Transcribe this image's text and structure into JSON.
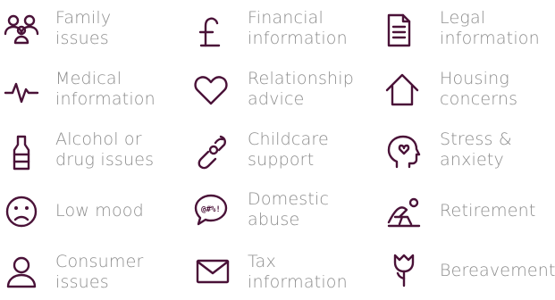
{
  "items": [
    {
      "label": "Family\nissues",
      "icon": "family-icon"
    },
    {
      "label": "Financial\ninformation",
      "icon": "pound-icon"
    },
    {
      "label": "Legal\ninformation",
      "icon": "document-icon"
    },
    {
      "label": "Medical\ninformation",
      "icon": "heartbeat-icon"
    },
    {
      "label": "Relationship\nadvice",
      "icon": "heart-icon"
    },
    {
      "label": "Housing\nconcerns",
      "icon": "house-icon"
    },
    {
      "label": "Alcohol or\ndrug issues",
      "icon": "bottle-icon"
    },
    {
      "label": "Childcare\nsupport",
      "icon": "pacifier-icon"
    },
    {
      "label": "Stress &\nanxiety",
      "icon": "head-icon"
    },
    {
      "label": "Low mood",
      "icon": "sad-face-icon"
    },
    {
      "label": "Domestic\nabuse",
      "icon": "speech-bubble-icon"
    },
    {
      "label": "Retirement",
      "icon": "sun-chair-icon"
    },
    {
      "label": "Consumer\nissues",
      "icon": "person-icon"
    },
    {
      "label": "Tax\ninformation",
      "icon": "envelope-icon"
    },
    {
      "label": "Bereavement",
      "icon": "flower-icon"
    }
  ],
  "icon_color": "#4a1238",
  "text_color": "#8d8d8d"
}
